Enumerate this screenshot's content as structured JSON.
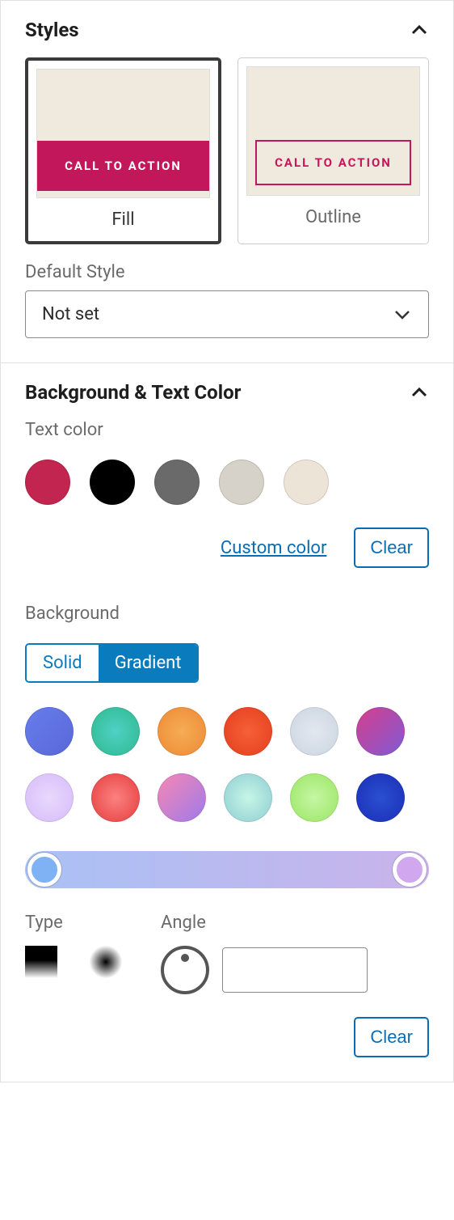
{
  "styles": {
    "title": "Styles",
    "options": [
      "Fill",
      "Outline"
    ],
    "selected": "Fill",
    "cta_text": "CALL TO ACTION",
    "default_label": "Default Style",
    "default_value": "Not set"
  },
  "bgtext": {
    "title": "Background & Text Color",
    "text_color_label": "Text color",
    "text_colors": [
      "#c2254f",
      "#000000",
      "#6a6a6a",
      "#d6d2c9",
      "#ece4d7"
    ],
    "custom_color": "Custom color",
    "clear": "Clear",
    "background_label": "Background",
    "bg_mode_options": [
      "Solid",
      "Gradient"
    ],
    "bg_mode_selected": "Gradient",
    "gradients": [
      "linear-gradient(135deg,#667eea,#5a67d8)",
      "radial-gradient(circle,#4fd1c5,#2fb98f)",
      "radial-gradient(circle,#f6ad55,#ed8936)",
      "radial-gradient(circle,#f56038,#e53e1e)",
      "radial-gradient(circle,#e2e8f0,#cbd5e0)",
      "linear-gradient(135deg,#d53f8c,#805ad5)",
      "radial-gradient(circle,#e9d8fd,#d6bcfa)",
      "radial-gradient(circle,#fc8181,#e53e3e)",
      "linear-gradient(135deg,#f687b3,#9f7aea)",
      "radial-gradient(circle,#c6f6e5,#90cdd4)",
      "radial-gradient(circle,#c6f6a5,#9ae663)",
      "radial-gradient(circle,#2b4fd0,#1a2fb8)"
    ],
    "current_gradient": "linear-gradient(90deg,#a9c1f5,#c9b3ea)",
    "type_label": "Type",
    "angle_label": "Angle",
    "angle_value": ""
  }
}
